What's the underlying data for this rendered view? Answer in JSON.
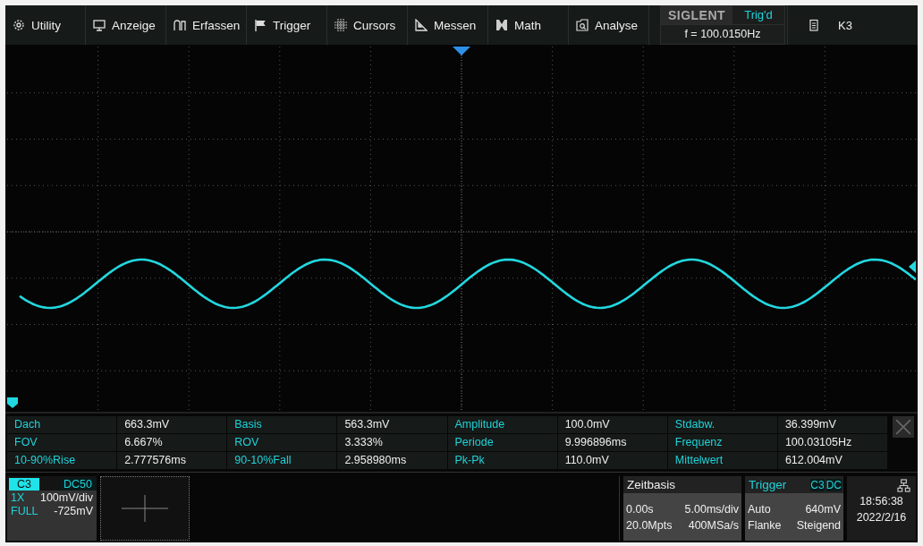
{
  "menu": [
    {
      "label": "Utility"
    },
    {
      "label": "Anzeige"
    },
    {
      "label": "Erfassen"
    },
    {
      "label": "Trigger"
    },
    {
      "label": "Cursors"
    },
    {
      "label": "Messen"
    },
    {
      "label": "Math"
    },
    {
      "label": "Analyse"
    }
  ],
  "header": {
    "brand": "SIGLENT",
    "trigger_status": "Trig'd",
    "frequency": "f = 100.0150Hz",
    "channel": "K3"
  },
  "measurements": [
    [
      {
        "name": "Dach",
        "value": "663.3mV"
      },
      {
        "name": "Basis",
        "value": "563.3mV"
      },
      {
        "name": "Amplitude",
        "value": "100.0mV"
      },
      {
        "name": "Stdabw.",
        "value": "36.399mV"
      }
    ],
    [
      {
        "name": "FOV",
        "value": "6.667%"
      },
      {
        "name": "ROV",
        "value": "3.333%"
      },
      {
        "name": "Periode",
        "value": "9.996896ms"
      },
      {
        "name": "Frequenz",
        "value": "100.03105Hz"
      }
    ],
    [
      {
        "name": "10-90%Rise",
        "value": "2.777576ms"
      },
      {
        "name": "90-10%Fall",
        "value": "2.958980ms"
      },
      {
        "name": "Pk-Pk",
        "value": "110.0mV"
      },
      {
        "name": "Mittelwert",
        "value": "612.004mV"
      }
    ]
  ],
  "channel": {
    "name": "C3",
    "coupling": "DC50",
    "probe": "1X",
    "scale": "100mV/div",
    "bandwidth": "FULL",
    "offset": "-725mV"
  },
  "timebase": {
    "title": "Zeitbasis",
    "delay": "0.00s",
    "scale": "5.00ms/div",
    "memory": "20.0Mpts",
    "sample_rate": "400MSa/s"
  },
  "trigger": {
    "title": "Trigger",
    "source": "C3",
    "coupling": "DC",
    "mode": "Auto",
    "level": "640mV",
    "type": "Flanke",
    "slope": "Steigend"
  },
  "clock": {
    "time": "18:56:38",
    "date": "2022/2/16"
  }
}
